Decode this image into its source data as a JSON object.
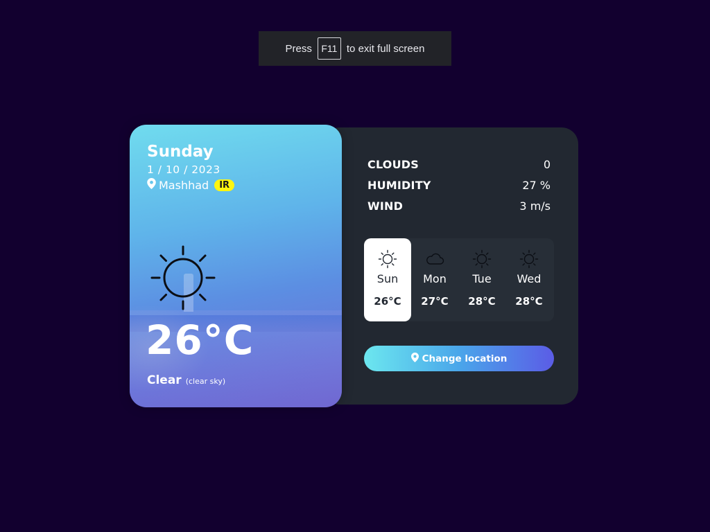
{
  "fullscreen_notice": {
    "prefix": "Press",
    "key": "F11",
    "suffix": "to exit full screen"
  },
  "card": {
    "day": "Sunday",
    "date": "1 / 10 / 2023",
    "city": "Mashhad",
    "country": "IR",
    "temperature": "26°C",
    "condition": "Clear",
    "condition_detail": "(clear sky)",
    "icon": "sun-icon"
  },
  "stats": [
    {
      "label": "CLOUDS",
      "value": "0"
    },
    {
      "label": "HUMIDITY",
      "value": "27 %"
    },
    {
      "label": "WIND",
      "value": "3 m/s"
    }
  ],
  "week": [
    {
      "day": "Sun",
      "temp": "26°C",
      "icon": "sun-icon",
      "active": true
    },
    {
      "day": "Mon",
      "temp": "27°C",
      "icon": "cloud-icon",
      "active": false
    },
    {
      "day": "Tue",
      "temp": "28°C",
      "icon": "sun-icon",
      "active": false
    },
    {
      "day": "Wed",
      "temp": "28°C",
      "icon": "sun-icon",
      "active": false
    }
  ],
  "change_location_label": "Change location",
  "colors": {
    "background": "#12002f",
    "panel": "#222831",
    "badge": "#fff50f",
    "button_gradient_start": "#6ce7ef",
    "button_gradient_end": "#5b5ce6"
  }
}
